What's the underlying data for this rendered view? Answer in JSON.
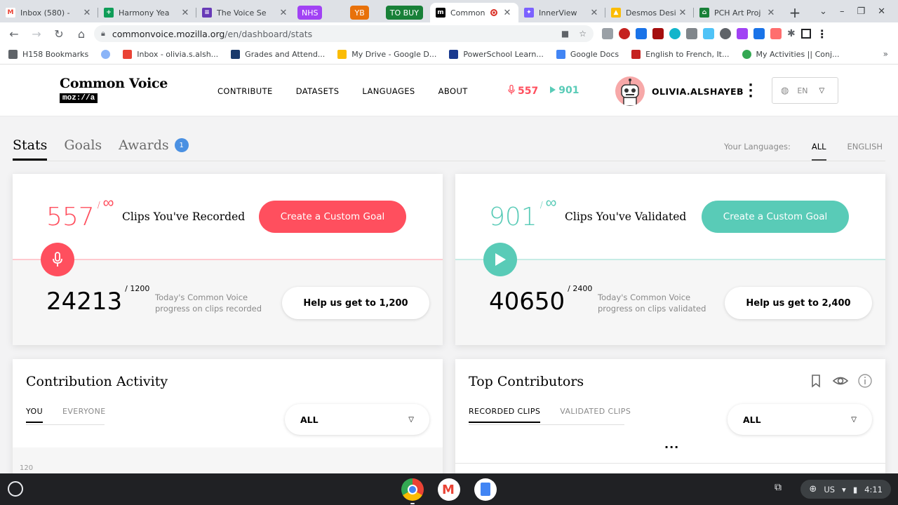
{
  "browser": {
    "tabs": [
      {
        "title": "Inbox (580) - ",
        "icon": "gmail-icon",
        "color": "#ea4335",
        "glyph": "M"
      },
      {
        "title": "Harmony Yea",
        "icon": "sheets-icon",
        "color": "#0f9d58",
        "glyph": "+"
      },
      {
        "title": "The Voice Se",
        "icon": "forms-icon",
        "color": "#673ab7",
        "glyph": "≡"
      },
      {
        "title": "Common",
        "icon": "mozilla-icon",
        "color": "#000000",
        "glyph": "m",
        "active": true
      },
      {
        "title": "InnerView",
        "icon": "innerview-icon",
        "color": "#7b61ff",
        "glyph": "✦"
      },
      {
        "title": "Desmos Desi",
        "icon": "drive-icon",
        "color": "#fbbc04",
        "glyph": "▲"
      },
      {
        "title": "PCH Art Proj",
        "icon": "site-icon",
        "color": "#188038",
        "glyph": "⌂"
      }
    ],
    "group_pills": [
      {
        "label": "NHS",
        "color": "#a142f4"
      },
      {
        "label": "YB",
        "color": "#e8710a"
      },
      {
        "label": "TO BUY",
        "color": "#188038"
      }
    ],
    "url_host": "commonvoice.mozilla.org",
    "url_path": "/en/dashboard/stats",
    "bookmarks": [
      {
        "label": "H158 Bookmarks",
        "icon": "folder-icon",
        "color": "#5f6368"
      },
      {
        "label": "",
        "icon": "bird-icon",
        "color": "#8ab4f8"
      },
      {
        "label": "Inbox - olivia.s.alsh...",
        "icon": "gmail-icon",
        "color": "#ea4335"
      },
      {
        "label": "Grades and Attend...",
        "icon": "sis-icon",
        "color": "#1a3a6b"
      },
      {
        "label": "My Drive - Google D...",
        "icon": "drive-icon",
        "color": "#fbbc04"
      },
      {
        "label": "PowerSchool Learn...",
        "icon": "powerschool-icon",
        "color": "#1a3a8f"
      },
      {
        "label": "Google Docs",
        "icon": "docs-icon",
        "color": "#4285f4"
      },
      {
        "label": "English to French, It...",
        "icon": "wordreference-icon",
        "color": "#c5221f"
      },
      {
        "label": "My Activities || Conj...",
        "icon": "frog-icon",
        "color": "#34a853"
      }
    ]
  },
  "site": {
    "logo_text": "Common Voice",
    "logo_sub": "moz://a",
    "nav": [
      "CONTRIBUTE",
      "DATASETS",
      "LANGUAGES",
      "ABOUT"
    ],
    "recorded_count": "557",
    "validated_count": "901",
    "username": "OLIVIA.ALSHAYEB",
    "language": "EN"
  },
  "dashboard": {
    "tabs": [
      {
        "label": "Stats",
        "active": true
      },
      {
        "label": "Goals"
      },
      {
        "label": "Awards",
        "badge": "1"
      }
    ],
    "your_languages_label": "Your Languages:",
    "lang_filters": [
      "ALL",
      "ENGLISH"
    ]
  },
  "stats": {
    "recorded": {
      "count": "557",
      "goal": "/",
      "infinity": "∞",
      "label": "Clips You've Recorded",
      "button": "Create a Custom Goal",
      "today_value": "24213",
      "today_goal": "/ 1200",
      "today_text": "Today's Common Voice progress on clips recorded",
      "help_button": "Help us get to 1,200"
    },
    "validated": {
      "count": "901",
      "goal": "/",
      "infinity": "∞",
      "label": "Clips You've Validated",
      "button": "Create a Custom Goal",
      "today_value": "40650",
      "today_goal": "/ 2400",
      "today_text": "Today's Common Voice progress on clips validated",
      "help_button": "Help us get to 2,400"
    }
  },
  "activity": {
    "title": "Contribution Activity",
    "subtabs": [
      "YOU",
      "EVERYONE"
    ],
    "dropdown": "ALL",
    "axis_top": "120"
  },
  "contributors": {
    "title": "Top Contributors",
    "subtabs": [
      "RECORDED CLIPS",
      "VALIDATED CLIPS"
    ],
    "dropdown": "ALL",
    "ellipsis": "..."
  },
  "shelf": {
    "locale": "US",
    "time": "4:11"
  },
  "colors": {
    "record": "#ff4f5e",
    "validate": "#59cbb7"
  }
}
